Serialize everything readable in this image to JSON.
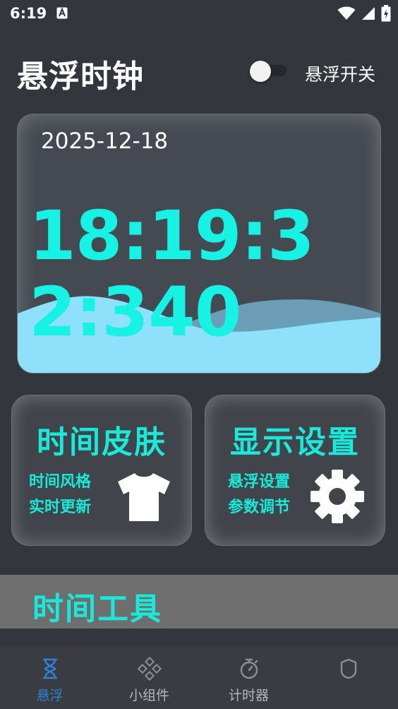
{
  "status_bar": {
    "time": "6:19"
  },
  "header": {
    "title": "悬浮时钟",
    "toggle_label": "悬浮开关",
    "toggle_on": false
  },
  "clock": {
    "date": "2025-12-18",
    "time": "18:19:32:340"
  },
  "cards": {
    "skin": {
      "title": "时间皮肤",
      "line1": "时间风格",
      "line2": "实时更新",
      "icon": "tshirt-icon"
    },
    "display": {
      "title": "显示设置",
      "line1": "悬浮设置",
      "line2": "参数调节",
      "icon": "gear-icon"
    }
  },
  "section": {
    "title": "时间工具"
  },
  "nav": {
    "items": [
      {
        "label": "悬浮",
        "icon": "hourglass-icon",
        "active": true
      },
      {
        "label": "小组件",
        "icon": "widget-icon",
        "active": false
      },
      {
        "label": "计时器",
        "icon": "stopwatch-icon",
        "active": false
      },
      {
        "label": "",
        "icon": "shield-icon",
        "active": false
      }
    ]
  },
  "colors": {
    "accent": "#16f3e5",
    "wave_light": "#8ee0fb",
    "wave_dark": "#6b9db6",
    "nav_active": "#2b82d9",
    "background": "#33363d"
  }
}
